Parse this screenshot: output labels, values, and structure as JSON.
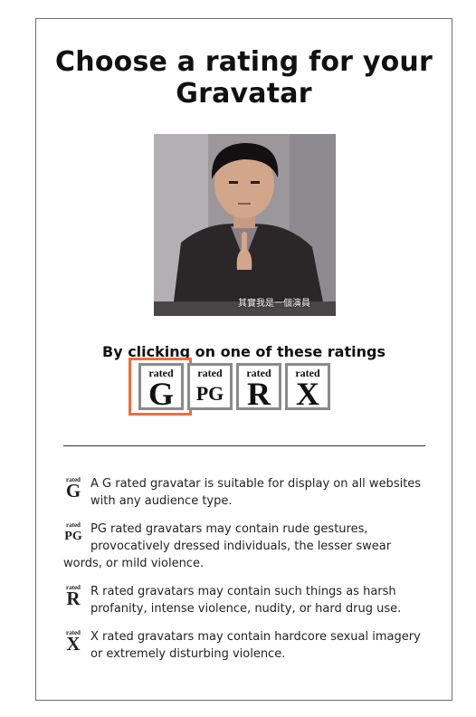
{
  "header": {
    "title": "Choose a rating for your Gravatar"
  },
  "photo": {
    "subtitle_caption": "其實我是一個演員"
  },
  "instructions": {
    "clicking_text": "By clicking on one of these ratings"
  },
  "ratings": [
    {
      "rated": "rated",
      "letter": "G",
      "selected": true
    },
    {
      "rated": "rated",
      "letter": "PG",
      "selected": false
    },
    {
      "rated": "rated",
      "letter": "R",
      "selected": false
    },
    {
      "rated": "rated",
      "letter": "X",
      "selected": false
    }
  ],
  "descriptions": [
    {
      "rated": "rated",
      "letter": "G",
      "text": "A G rated gravatar is suitable for display on all websites with any audience type."
    },
    {
      "rated": "rated",
      "letter": "PG",
      "text": "PG rated gravatars may contain rude gestures, provocatively dressed individuals, the lesser swear words, or mild violence."
    },
    {
      "rated": "rated",
      "letter": "R",
      "text": "R rated gravatars may contain such things as harsh profanity, intense violence, nudity, or hard drug use."
    },
    {
      "rated": "rated",
      "letter": "X",
      "text": "X rated gravatars may contain hardcore sexual imagery or extremely disturbing violence."
    }
  ],
  "colors": {
    "selection_ring": "#f26d3d",
    "button_border": "#8a8a8a",
    "panel_border": "#6f6f6f"
  }
}
